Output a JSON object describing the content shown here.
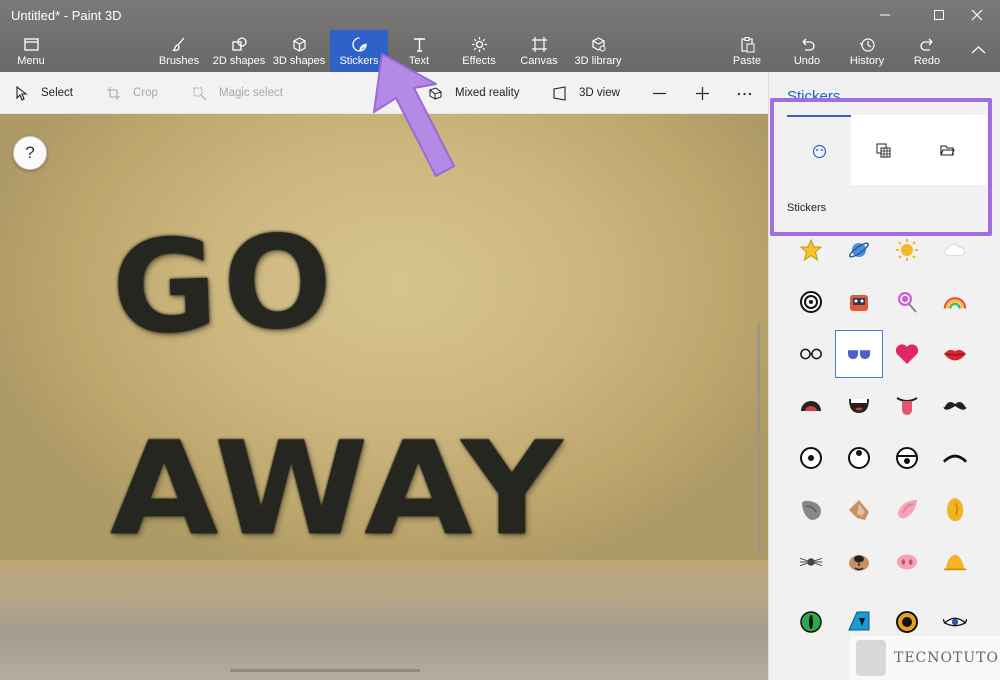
{
  "window": {
    "title": "Untitled* - Paint 3D"
  },
  "toolbar": {
    "menu": "Menu",
    "tools": [
      {
        "label": "Brushes",
        "icon": "brush-icon"
      },
      {
        "label": "2D shapes",
        "icon": "2d-shapes-icon"
      },
      {
        "label": "3D shapes",
        "icon": "cube-icon"
      },
      {
        "label": "Stickers",
        "icon": "stickers-icon",
        "active": true
      },
      {
        "label": "Text",
        "icon": "text-icon"
      },
      {
        "label": "Effects",
        "icon": "effects-icon"
      },
      {
        "label": "Canvas",
        "icon": "canvas-icon"
      },
      {
        "label": "3D library",
        "icon": "3d-library-icon"
      }
    ],
    "actions": [
      {
        "label": "Paste",
        "icon": "paste-icon"
      },
      {
        "label": "Undo",
        "icon": "undo-icon"
      },
      {
        "label": "History",
        "icon": "history-icon"
      },
      {
        "label": "Redo",
        "icon": "redo-icon"
      }
    ]
  },
  "subtoolbar": {
    "select": "Select",
    "crop": "Crop",
    "magic_select": "Magic select",
    "mixed_reality": "Mixed reality",
    "view_3d": "3D view"
  },
  "canvas": {
    "help": "?",
    "text_line1": "GO",
    "text_line2": "AWAY"
  },
  "panel": {
    "title": "Stickers",
    "tabs": [
      "stickers-tab-icon",
      "textures-tab-icon",
      "folder-tab-icon"
    ],
    "sublabel": "Stickers",
    "stickers": [
      [
        "star",
        "planet",
        "sun",
        "cloud"
      ],
      [
        "spiral",
        "robot",
        "lollipop",
        "rainbow"
      ],
      [
        "glasses",
        "sunglasses",
        "heart",
        "lips"
      ],
      [
        "mouth-open",
        "mouth-teeth",
        "tongue",
        "mustache"
      ],
      [
        "eye-round",
        "eye-up",
        "eye-down",
        "eyebrow"
      ],
      [
        "ear-grey",
        "ear-brown",
        "ear-pink",
        "ear-yellow"
      ],
      [
        "nose-mouse",
        "nose-dog",
        "nose-pig",
        "nose-yellow"
      ],
      [
        "eye-green",
        "eye-blue",
        "eye-orange",
        "eye-lash"
      ]
    ]
  },
  "watermark": "TECNOTUTO",
  "colors": {
    "accent": "#2f61c9",
    "highlight": "#a06ee0",
    "toolbar": "#6f6e6c"
  }
}
